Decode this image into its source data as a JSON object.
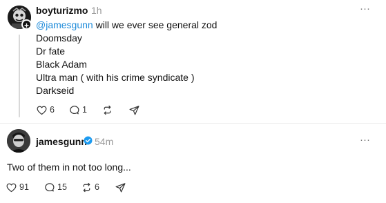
{
  "post1": {
    "username": "boyturizmo",
    "time": "1h",
    "mention": "@jamesgunn",
    "lines": [
      " will we ever see general zod",
      "Doomsday",
      "Dr fate",
      "Black Adam",
      "Ultra man ( with his crime syndicate )",
      "Darkseid"
    ],
    "likes": "6",
    "replies": "1",
    "more": "···",
    "follow_badge": "+"
  },
  "post2": {
    "username": "jamesgunn",
    "time": "54m",
    "text": "Two of them in not too long...",
    "likes": "91",
    "replies": "15",
    "reposts": "6",
    "more": "···"
  },
  "colors": {
    "mention": "#1d8ad9",
    "verified": "#1d9bf0",
    "muted": "#9a9a9a"
  },
  "icons": [
    "heart-icon",
    "comment-icon",
    "repost-icon",
    "share-icon",
    "verified-icon",
    "more-icon",
    "plus-icon"
  ]
}
